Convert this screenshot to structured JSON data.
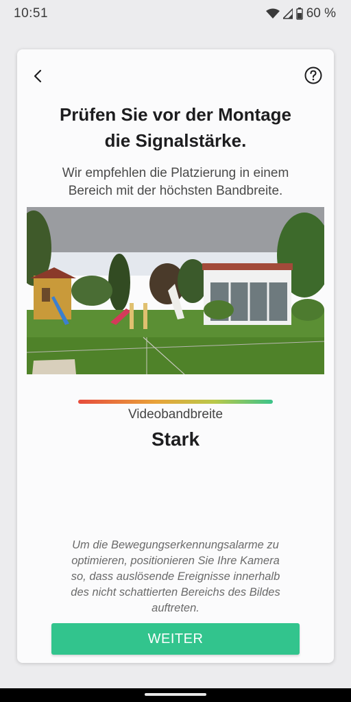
{
  "status": {
    "time": "10:51",
    "battery": "60 %",
    "icons": [
      "wifi-icon",
      "signal-icon",
      "battery-icon"
    ]
  },
  "header": {
    "back_icon": "chevron-left-icon",
    "help_icon": "help-circle-icon",
    "title_line1": "Prüfen Sie vor der Montage",
    "title_line2": "die Signalstärke.",
    "subtitle_line1": "Wir empfehlen die Platzierung in einem",
    "subtitle_line2": "Bereich mit der höchsten Bandbreite."
  },
  "signal": {
    "label": "Videobandbreite",
    "value": "Stark",
    "colors": [
      "#e74c3c",
      "#e8a33a",
      "#b9c84a",
      "#3cc38a"
    ]
  },
  "note": {
    "line1": "Um die Bewegungserkennungsalarme zu",
    "line2": "optimieren, positionieren Sie Ihre Kamera",
    "line3": "so, dass auslösende Ereignisse innerhalb",
    "line4": "des nicht schattierten Bereichs des Bildes",
    "line5": "auftreten."
  },
  "actions": {
    "continue_label": "WEITER",
    "accent": "#32c48d"
  }
}
